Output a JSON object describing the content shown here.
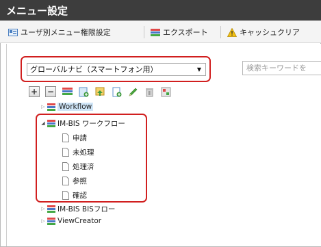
{
  "window": {
    "title": "メニュー設定"
  },
  "toolbar": {
    "buttons": [
      {
        "label": "ユーザ別メニュー権限設定",
        "icon": "user-menu-permission-icon"
      },
      {
        "label": "エクスポート",
        "icon": "export-icon"
      },
      {
        "label": "キャッシュクリア",
        "icon": "warning-icon"
      }
    ]
  },
  "menu_select": {
    "value": "グローバルナビ（スマートフォン用）"
  },
  "search": {
    "placeholder": "検索キーワードを"
  },
  "tree_toolbar": {
    "actions": [
      "expand-all",
      "collapse-all",
      "add-menu",
      "add-folder",
      "import",
      "add-page",
      "edit",
      "delete",
      "preview"
    ]
  },
  "tree": {
    "nodes": [
      {
        "label": "Workflow",
        "expanded": false,
        "selected": true,
        "children": []
      },
      {
        "label": "IM-BIS ワークフロー",
        "expanded": true,
        "selected": false,
        "children": [
          "申請",
          "未処理",
          "処理済",
          "参照",
          "確認"
        ]
      },
      {
        "label": "IM-BIS BISフロー",
        "expanded": false,
        "selected": false,
        "children": []
      },
      {
        "label": "ViewCreator",
        "expanded": false,
        "selected": false,
        "children": []
      }
    ]
  },
  "colors": {
    "highlight": "#d11f1f",
    "titlebar": "#3d3d3d",
    "selected": "#cfe5f7"
  }
}
